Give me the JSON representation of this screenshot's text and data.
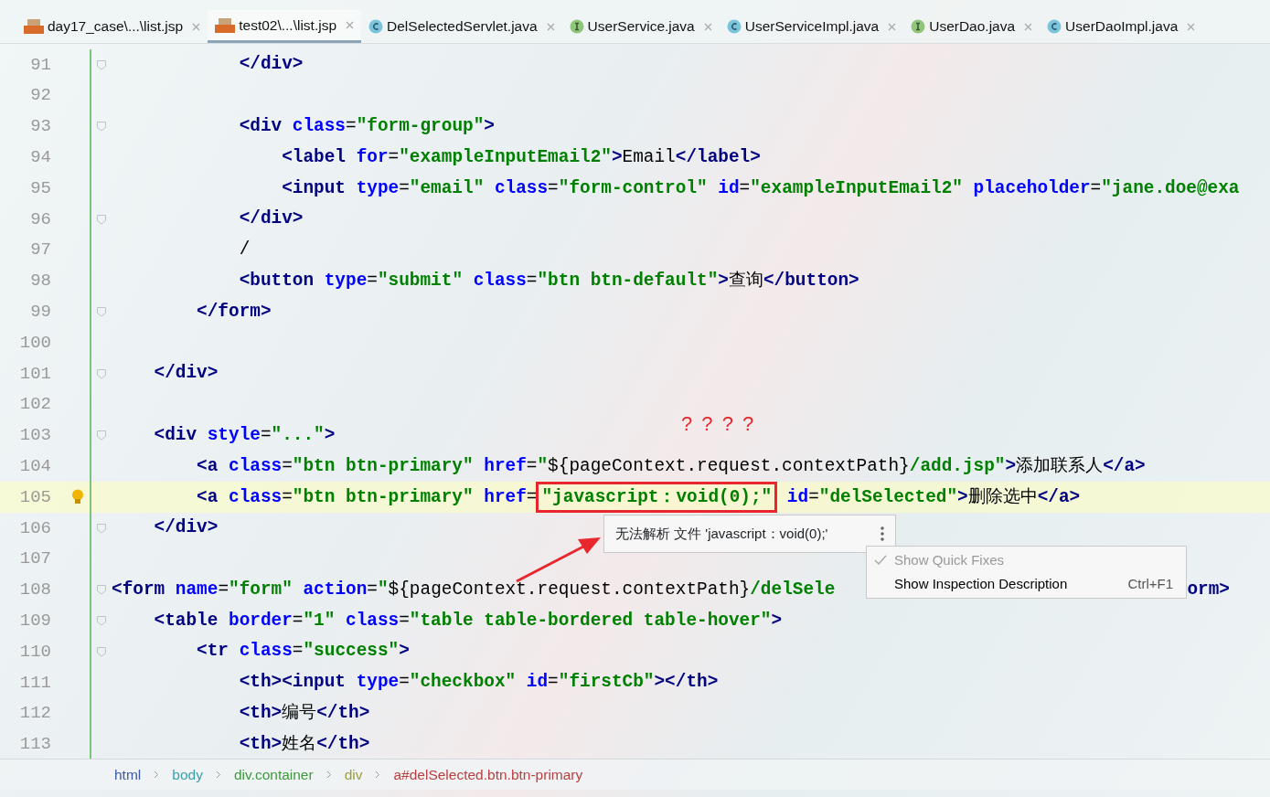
{
  "tabs": [
    {
      "label": "day17_case\\...\\list.jsp",
      "kind": "jsp",
      "selected": false
    },
    {
      "label": "test02\\...\\list.jsp",
      "kind": "jsp",
      "selected": true
    },
    {
      "label": "DelSelectedServlet.java",
      "kind": "class",
      "selected": false
    },
    {
      "label": "UserService.java",
      "kind": "interface",
      "selected": false
    },
    {
      "label": "UserServiceImpl.java",
      "kind": "class",
      "selected": false
    },
    {
      "label": "UserDao.java",
      "kind": "interface",
      "selected": false
    },
    {
      "label": "UserDaoImpl.java",
      "kind": "class",
      "selected": false
    }
  ],
  "editor": {
    "lines": [
      {
        "number": "91",
        "fold": true,
        "current": false,
        "bulb": false,
        "segs": [
          {
            "kind": "tag",
            "text": "            </div>"
          }
        ]
      },
      {
        "number": "92",
        "fold": false,
        "current": false,
        "bulb": false
      },
      {
        "number": "93",
        "fold": true,
        "current": false,
        "bulb": false,
        "segs": [
          {
            "kind": "tag",
            "text": "            <div "
          },
          {
            "kind": "attr",
            "text": "class"
          },
          {
            "kind": "plain",
            "text": "="
          },
          {
            "kind": "string",
            "text": "\"form-group\""
          },
          {
            "kind": "tag",
            "text": ">"
          }
        ]
      },
      {
        "number": "94",
        "fold": false,
        "current": false,
        "bulb": false,
        "segs": [
          {
            "kind": "tag",
            "text": "                <label "
          },
          {
            "kind": "attr",
            "text": "for"
          },
          {
            "kind": "plain",
            "text": "="
          },
          {
            "kind": "string",
            "text": "\"exampleInputEmail2\""
          },
          {
            "kind": "tag",
            "text": ">"
          },
          {
            "kind": "plain",
            "text": "Email"
          },
          {
            "kind": "tag",
            "text": "</label>"
          }
        ]
      },
      {
        "number": "95",
        "fold": false,
        "current": false,
        "bulb": false,
        "segs": [
          {
            "kind": "tag",
            "text": "                <input "
          },
          {
            "kind": "attr",
            "text": "type"
          },
          {
            "kind": "plain",
            "text": "="
          },
          {
            "kind": "string",
            "text": "\"email\" "
          },
          {
            "kind": "attr",
            "text": "class"
          },
          {
            "kind": "plain",
            "text": "="
          },
          {
            "kind": "string",
            "text": "\"form-control\" "
          },
          {
            "kind": "attr",
            "text": "id"
          },
          {
            "kind": "plain",
            "text": "="
          },
          {
            "kind": "string",
            "text": "\"exampleInputEmail2\" "
          },
          {
            "kind": "attr",
            "text": "placeholder"
          },
          {
            "kind": "plain",
            "text": "="
          },
          {
            "kind": "string",
            "text": "\"jane.doe@exa"
          }
        ]
      },
      {
        "number": "96",
        "fold": true,
        "current": false,
        "bulb": false,
        "segs": [
          {
            "kind": "tag",
            "text": "            </div>"
          }
        ]
      },
      {
        "number": "97",
        "fold": false,
        "current": false,
        "bulb": false,
        "segs": [
          {
            "kind": "plain",
            "text": "            /"
          }
        ]
      },
      {
        "number": "98",
        "fold": false,
        "current": false,
        "bulb": false,
        "segs": [
          {
            "kind": "tag",
            "text": "            <button "
          },
          {
            "kind": "attr",
            "text": "type"
          },
          {
            "kind": "plain",
            "text": "="
          },
          {
            "kind": "string",
            "text": "\"submit\" "
          },
          {
            "kind": "attr",
            "text": "class"
          },
          {
            "kind": "plain",
            "text": "="
          },
          {
            "kind": "string",
            "text": "\"btn btn-default\""
          },
          {
            "kind": "tag",
            "text": ">"
          },
          {
            "kind": "plain",
            "text": "查询"
          },
          {
            "kind": "tag",
            "text": "</button>"
          }
        ]
      },
      {
        "number": "99",
        "fold": true,
        "current": false,
        "bulb": false,
        "segs": [
          {
            "kind": "tag",
            "text": "        </form>"
          }
        ]
      },
      {
        "number": "100",
        "fold": false,
        "current": false,
        "bulb": false
      },
      {
        "number": "101",
        "fold": true,
        "current": false,
        "bulb": false,
        "segs": [
          {
            "kind": "tag",
            "text": "    </div>"
          }
        ]
      },
      {
        "number": "102",
        "fold": false,
        "current": false,
        "bulb": false
      },
      {
        "number": "103",
        "fold": true,
        "current": false,
        "bulb": false,
        "segs": [
          {
            "kind": "tag",
            "text": "    <div "
          },
          {
            "kind": "attr",
            "text": "style"
          },
          {
            "kind": "plain",
            "text": "="
          },
          {
            "kind": "string",
            "text": "\"...\""
          },
          {
            "kind": "tag",
            "text": ">"
          }
        ]
      },
      {
        "number": "104",
        "fold": false,
        "current": false,
        "bulb": false,
        "segs": [
          {
            "kind": "tag",
            "text": "        <a "
          },
          {
            "kind": "attr",
            "text": "class"
          },
          {
            "kind": "plain",
            "text": "="
          },
          {
            "kind": "string",
            "text": "\"btn btn-primary\" "
          },
          {
            "kind": "attr",
            "text": "href"
          },
          {
            "kind": "plain",
            "text": "="
          },
          {
            "kind": "string",
            "text": "\""
          },
          {
            "kind": "plain",
            "text": "${pageContext.request.contextPath}"
          },
          {
            "kind": "string",
            "text": "/add.jsp\""
          },
          {
            "kind": "tag",
            "text": ">"
          },
          {
            "kind": "plain",
            "text": "添加联系人"
          },
          {
            "kind": "tag",
            "text": "</a>"
          }
        ]
      },
      {
        "number": "105",
        "fold": false,
        "current": true,
        "bulb": true,
        "segs": [
          {
            "kind": "tag",
            "text": "        <a "
          },
          {
            "kind": "attr",
            "text": "class"
          },
          {
            "kind": "plain",
            "text": "="
          },
          {
            "kind": "string",
            "text": "\"btn btn-primary\" "
          },
          {
            "kind": "attr",
            "text": "href"
          },
          {
            "kind": "plain",
            "text": "="
          },
          {
            "kind": "boxed",
            "text": "\"javascript：void(0);\""
          },
          {
            "kind": "attr",
            "text": " id"
          },
          {
            "kind": "plain",
            "text": "="
          },
          {
            "kind": "string",
            "text": "\"delSelected\""
          },
          {
            "kind": "tag",
            "text": ">"
          },
          {
            "kind": "plain",
            "text": "删除选中"
          },
          {
            "kind": "tag",
            "text": "</a>"
          }
        ]
      },
      {
        "number": "106",
        "fold": true,
        "current": false,
        "bulb": false,
        "segs": [
          {
            "kind": "tag",
            "text": "    </div>"
          }
        ]
      },
      {
        "number": "107",
        "fold": false,
        "current": false,
        "bulb": false
      },
      {
        "number": "108",
        "fold": true,
        "current": false,
        "bulb": false,
        "segs": [
          {
            "kind": "tag",
            "text": "<form "
          },
          {
            "kind": "attr",
            "text": "name"
          },
          {
            "kind": "plain",
            "text": "="
          },
          {
            "kind": "string",
            "text": "\"form\" "
          },
          {
            "kind": "attr",
            "text": "action"
          },
          {
            "kind": "plain",
            "text": "="
          },
          {
            "kind": "string",
            "text": "\""
          },
          {
            "kind": "plain",
            "text": "${pageContext.request.contextPath}"
          },
          {
            "kind": "string",
            "text": "/delSele"
          }
        ],
        "tail": "orm>"
      },
      {
        "number": "109",
        "fold": true,
        "current": false,
        "bulb": false,
        "segs": [
          {
            "kind": "tag",
            "text": "    <table "
          },
          {
            "kind": "attr",
            "text": "border"
          },
          {
            "kind": "plain",
            "text": "="
          },
          {
            "kind": "string",
            "text": "\"1\" "
          },
          {
            "kind": "attr",
            "text": "class"
          },
          {
            "kind": "plain",
            "text": "="
          },
          {
            "kind": "string",
            "text": "\"table table-bordered table-hover\""
          },
          {
            "kind": "tag",
            "text": ">"
          }
        ]
      },
      {
        "number": "110",
        "fold": true,
        "current": false,
        "bulb": false,
        "segs": [
          {
            "kind": "tag",
            "text": "        <tr "
          },
          {
            "kind": "attr",
            "text": "class"
          },
          {
            "kind": "plain",
            "text": "="
          },
          {
            "kind": "string",
            "text": "\"success\""
          },
          {
            "kind": "tag",
            "text": ">"
          }
        ]
      },
      {
        "number": "111",
        "fold": false,
        "current": false,
        "bulb": false,
        "segs": [
          {
            "kind": "tag",
            "text": "            <th><input "
          },
          {
            "kind": "attr",
            "text": "type"
          },
          {
            "kind": "plain",
            "text": "="
          },
          {
            "kind": "string",
            "text": "\"checkbox\" "
          },
          {
            "kind": "attr",
            "text": "id"
          },
          {
            "kind": "plain",
            "text": "="
          },
          {
            "kind": "string",
            "text": "\"firstCb\""
          },
          {
            "kind": "tag",
            "text": "></th>"
          }
        ]
      },
      {
        "number": "112",
        "fold": false,
        "current": false,
        "bulb": false,
        "segs": [
          {
            "kind": "tag",
            "text": "            <th>"
          },
          {
            "kind": "plain",
            "text": "编号"
          },
          {
            "kind": "tag",
            "text": "</th>"
          }
        ]
      },
      {
        "number": "113",
        "fold": false,
        "current": false,
        "bulb": false,
        "segs": [
          {
            "kind": "tag",
            "text": "            <th>"
          },
          {
            "kind": "plain",
            "text": "姓名"
          },
          {
            "kind": "tag",
            "text": "</th>"
          }
        ]
      }
    ]
  },
  "annotation": {
    "text": "? ? ? ?"
  },
  "tooltip": {
    "message": "无法解析 文件 'javascript：void(0);'"
  },
  "menu": [
    {
      "label": "Show Quick Fixes",
      "checked": true,
      "disabled": true
    },
    {
      "label": "Show Inspection Description",
      "checked": false,
      "disabled": false,
      "shortcut": "Ctrl+F1"
    }
  ],
  "breadcrumb": [
    {
      "label": "html",
      "color": "#3b5ba5"
    },
    {
      "label": "body",
      "color": "#3aa0a8"
    },
    {
      "label": "div.container",
      "color": "#3c9a3c"
    },
    {
      "label": "div",
      "color": "#9aa040"
    },
    {
      "label": "a#delSelected.btn.btn-primary",
      "color": "#b84040"
    }
  ]
}
